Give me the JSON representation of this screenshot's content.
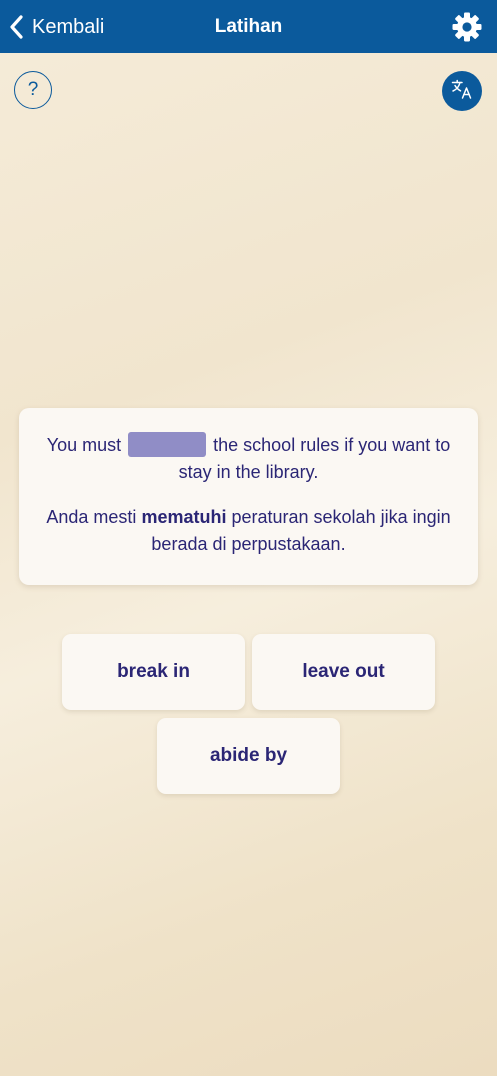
{
  "header": {
    "back_label": "Kembali",
    "title": "Latihan",
    "back_icon": "chevron-left-icon",
    "settings_icon": "gear-icon",
    "color": "#0b5a9c"
  },
  "toolbar": {
    "help_label": "?",
    "translate_icon": "translate-icon"
  },
  "question": {
    "english_before": "You must",
    "english_after": "the school rules if you want to stay in the library.",
    "indonesian_before": "Anda mesti",
    "indonesian_highlight": "mematuhi",
    "indonesian_after": "peraturan sekolah jika ingin berada di perpustakaan.",
    "blank_color": "#908dc6"
  },
  "options": [
    {
      "label": "break in"
    },
    {
      "label": "leave out"
    },
    {
      "label": "abide by"
    }
  ]
}
